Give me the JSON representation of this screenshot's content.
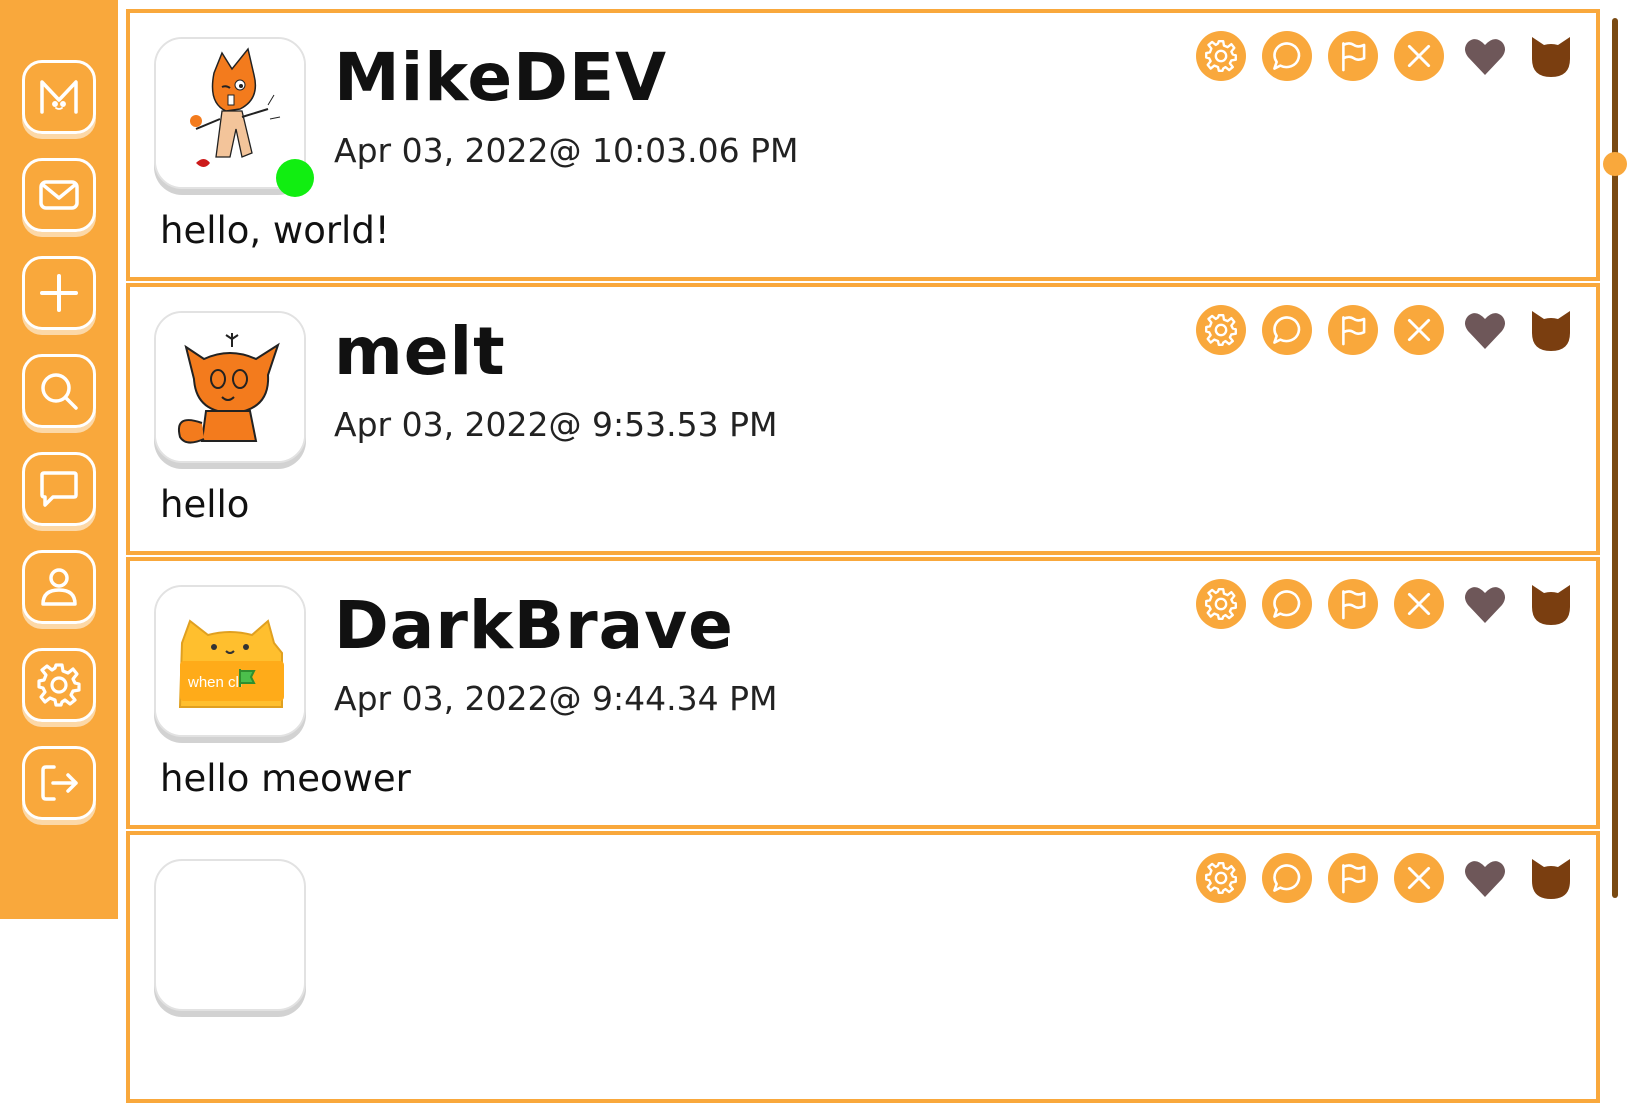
{
  "colors": {
    "accent": "#f9a83c",
    "sidebar_bg": "#f9a83c",
    "heart": "#6e5759",
    "cat": "#7a3e10",
    "online": "#11ee11"
  },
  "sidebar": {
    "items": [
      {
        "icon": "meower-logo-icon",
        "label": ""
      },
      {
        "icon": "mail-icon",
        "label": ""
      },
      {
        "icon": "plus-icon",
        "label": ""
      },
      {
        "icon": "search-icon",
        "label": ""
      },
      {
        "icon": "chat-icon",
        "label": ""
      },
      {
        "icon": "profile-icon",
        "label": ""
      },
      {
        "icon": "gear-icon",
        "label": ""
      },
      {
        "icon": "logout-icon",
        "label": ""
      }
    ]
  },
  "posts": [
    {
      "username": "MikeDEV",
      "timestamp": "Apr 03, 2022@ 10:03.06 PM",
      "content": "hello, world!",
      "online": true,
      "actions": [
        "gear-icon",
        "reply-icon",
        "flag-icon",
        "close-icon",
        "heart-icon",
        "cat-icon"
      ]
    },
    {
      "username": "melt",
      "timestamp": "Apr 03, 2022@ 9:53.53 PM",
      "content": "hello",
      "online": false,
      "actions": [
        "gear-icon",
        "reply-icon",
        "flag-icon",
        "close-icon",
        "heart-icon",
        "cat-icon"
      ]
    },
    {
      "username": "DarkBrave",
      "timestamp": "Apr 03, 2022@ 9:44.34 PM",
      "content": "hello meower",
      "avatar_text": "when   cli",
      "online": false,
      "actions": [
        "gear-icon",
        "reply-icon",
        "flag-icon",
        "close-icon",
        "heart-icon",
        "cat-icon"
      ]
    },
    {
      "username": "",
      "timestamp": "",
      "content": "",
      "online": false,
      "actions": [
        "gear-icon",
        "reply-icon",
        "flag-icon",
        "close-icon",
        "heart-icon",
        "cat-icon"
      ]
    }
  ]
}
